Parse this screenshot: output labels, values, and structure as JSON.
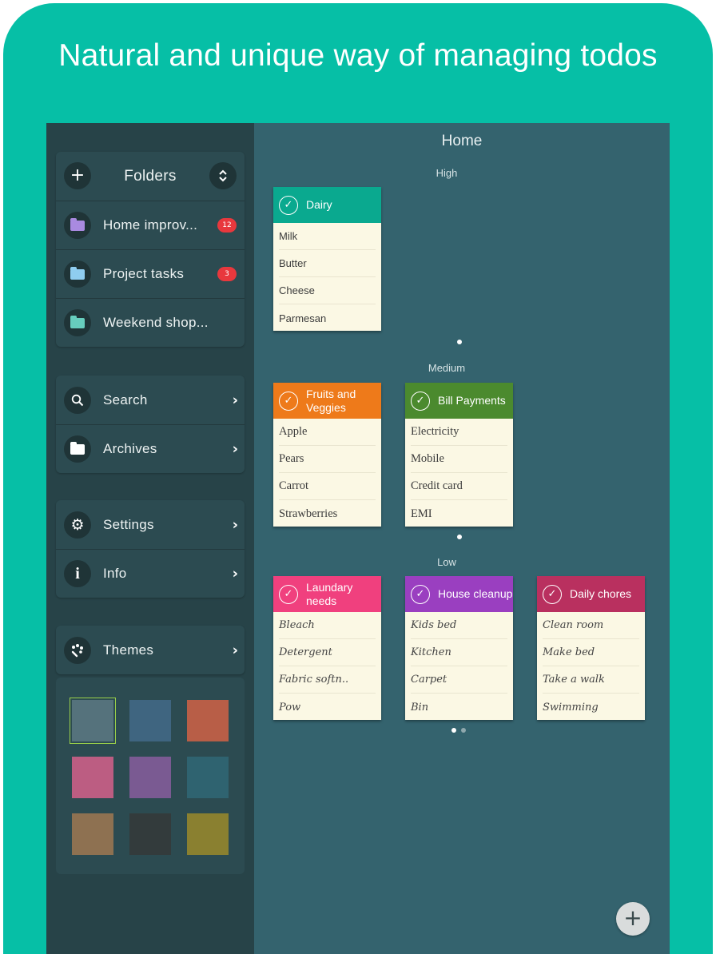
{
  "headline": "Natural and unique way of managing todos",
  "board": {
    "title": "Home",
    "sections": [
      {
        "label": "High",
        "notes": [
          {
            "title": "Dairy",
            "color": "#0aa98f",
            "items": [
              "Milk",
              "Butter",
              "Cheese",
              "Parmesan"
            ]
          }
        ]
      },
      {
        "label": "Medium",
        "notes": [
          {
            "title": "Fruits and Veggies",
            "color": "#ee7a1a",
            "items": [
              "Apple",
              "Pears",
              "Carrot",
              "Strawberries"
            ]
          },
          {
            "title": "Bill Payments",
            "color": "#4b8a2e",
            "items": [
              "Electricity",
              "Mobile",
              "Credit card",
              "EMI"
            ]
          }
        ]
      },
      {
        "label": "Low",
        "notes": [
          {
            "title": "Laundary needs",
            "color": "#f0407e",
            "items": [
              "Bleach",
              "Detergent",
              "Fabric softn..",
              "Pow"
            ]
          },
          {
            "title": "House cleanup",
            "color": "#9a3fc0",
            "items": [
              "Kids bed",
              "Kitchen",
              "Carpet",
              "Bin"
            ]
          },
          {
            "title": "Daily chores",
            "color": "#b9305f",
            "items": [
              "Clean room",
              "Make bed",
              "Take a walk",
              "Swimming"
            ]
          }
        ]
      }
    ]
  },
  "sidebar": {
    "folders_header": "Folders",
    "folders": [
      {
        "label": "Home improv...",
        "badge": "12",
        "color": "#a98ae0"
      },
      {
        "label": "Project tasks",
        "badge": "3",
        "color": "#8fcdf0"
      },
      {
        "label": "Weekend shop...",
        "badge": "",
        "color": "#67cdbd"
      }
    ],
    "nav": [
      {
        "label": "Search",
        "icon": "search-icon"
      },
      {
        "label": "Archives",
        "icon": "folder-icon"
      }
    ],
    "misc": [
      {
        "label": "Settings",
        "icon": "gear-icon"
      },
      {
        "label": "Info",
        "icon": "info-icon"
      }
    ],
    "themes_label": "Themes",
    "theme_colors": [
      "#55727c",
      "#3f6580",
      "#b85e47",
      "#bc5d82",
      "#7a5a92",
      "#2f6370",
      "#8e7151",
      "#333b3c",
      "#8a8030"
    ]
  },
  "accent": "#06bfa6"
}
